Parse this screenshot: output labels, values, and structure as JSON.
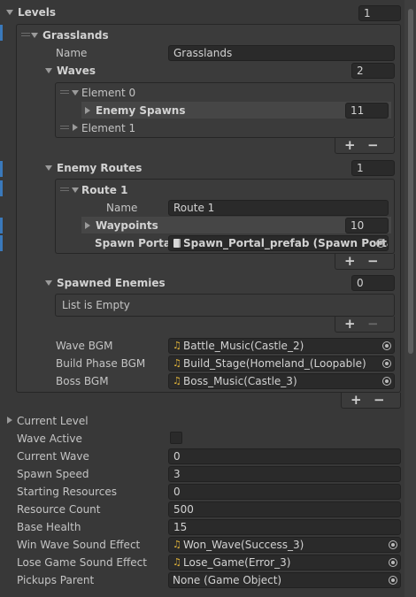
{
  "levels": {
    "label": "Levels",
    "count": "1",
    "grasslands": {
      "label": "Grasslands",
      "name_label": "Name",
      "name_value": "Grasslands",
      "waves": {
        "label": "Waves",
        "count": "2",
        "element0": {
          "label": "Element 0",
          "enemy_spawns_label": "Enemy Spawns",
          "enemy_spawns_count": "11"
        },
        "element1": {
          "label": "Element 1"
        }
      },
      "enemy_routes": {
        "label": "Enemy Routes",
        "count": "1",
        "route1": {
          "label": "Route 1",
          "name_label": "Name",
          "name_value": "Route 1",
          "waypoints_label": "Waypoints",
          "waypoints_count": "10",
          "spawn_portal_label": "Spawn Portal",
          "spawn_portal_value": "Spawn_Portal_prefab (Spawn Portal"
        }
      },
      "spawned_enemies": {
        "label": "Spawned Enemies",
        "count": "0",
        "empty_text": "List is Empty"
      },
      "wave_bgm_label": "Wave BGM",
      "wave_bgm_value": "Battle_Music(Castle_2)",
      "build_bgm_label": "Build Phase BGM",
      "build_bgm_value": "Build_Stage(Homeland_(Loopable)",
      "boss_bgm_label": "Boss BGM",
      "boss_bgm_value": "Boss_Music(Castle_3)"
    }
  },
  "list_controls": {
    "plus": "+",
    "minus": "−"
  },
  "fields": {
    "current_level": "Current Level",
    "wave_active": "Wave Active",
    "current_wave_label": "Current Wave",
    "current_wave_value": "0",
    "spawn_speed_label": "Spawn Speed",
    "spawn_speed_value": "3",
    "starting_resources_label": "Starting Resources",
    "starting_resources_value": "0",
    "resource_count_label": "Resource Count",
    "resource_count_value": "500",
    "base_health_label": "Base Health",
    "base_health_value": "15",
    "win_wave_label": "Win Wave Sound Effect",
    "win_wave_value": "Won_Wave(Success_3)",
    "lose_game_label": "Lose Game Sound Effect",
    "lose_game_value": "Lose_Game(Error_3)",
    "pickups_parent_label": "Pickups Parent",
    "pickups_parent_value": "None (Game Object)"
  },
  "icons": {
    "audio": "music-note-icon",
    "prefab": "prefab-file-icon",
    "picker": "object-picker-icon",
    "foldout": "foldout-arrow-icon",
    "reorder": "drag-handle-icon"
  },
  "colors": {
    "background": "#383838",
    "field": "#2a2a2a",
    "selection_accent": "#3a79bb",
    "audio_icon": "#e0b33a"
  }
}
